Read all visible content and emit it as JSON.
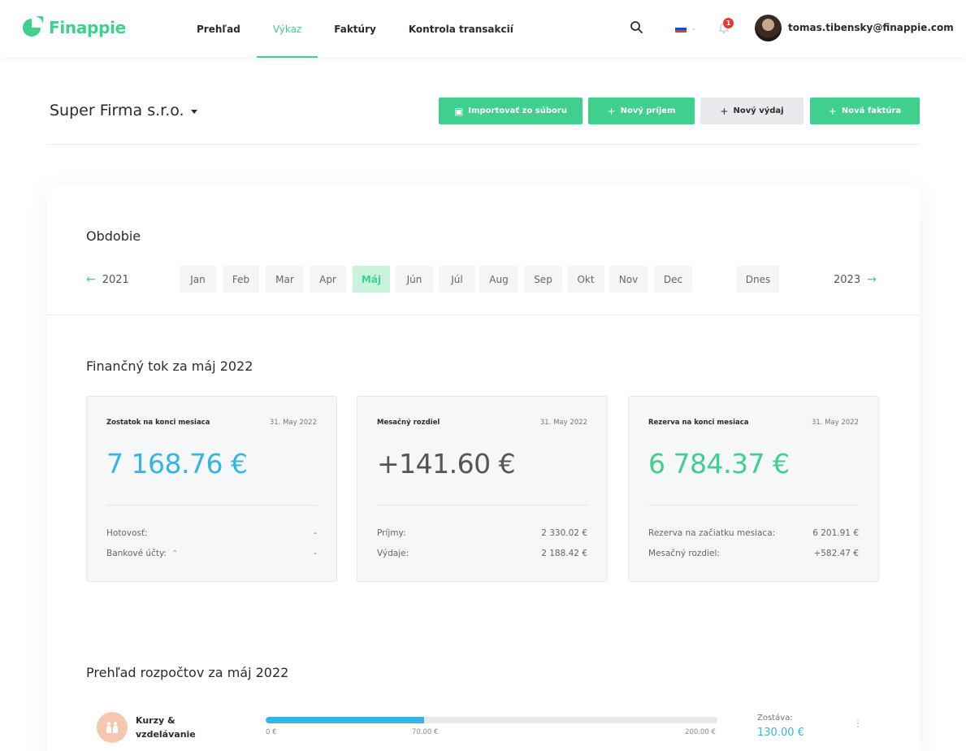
{
  "app": {
    "name": "Finappie"
  },
  "nav": {
    "items": [
      {
        "label": "Prehľad",
        "active": false
      },
      {
        "label": "Výkaz",
        "active": true
      },
      {
        "label": "Faktúry",
        "active": false
      },
      {
        "label": "Kontrola transakcií",
        "active": false
      }
    ],
    "search_icon": "search-icon",
    "language": "sk",
    "notifications_count": "1",
    "user_email": "tomas.tibensky@finappie.com"
  },
  "header": {
    "company": "Super Firma s.r.o.",
    "buttons": {
      "import": "Importovať zo súboru",
      "new_income": "Nový príjem",
      "new_expense": "Nový výdaj",
      "new_invoice": "Nová faktúra"
    }
  },
  "period": {
    "title": "Obdobie",
    "prev_year": "2021",
    "next_year": "2023",
    "months": [
      "Jan",
      "Feb",
      "Mar",
      "Apr",
      "Máj",
      "Jún",
      "Júl",
      "Aug",
      "Sep",
      "Okt",
      "Nov",
      "Dec"
    ],
    "active_month": "Máj",
    "today_label": "Dnes"
  },
  "cashflow": {
    "title": "Finančný tok za máj 2022",
    "tiles": [
      {
        "title": "Zostatok na konci mesiaca",
        "date": "31. May 2022",
        "amount": "7 168.76 €",
        "rows": [
          {
            "label": "Hotovosť:",
            "value": "-"
          },
          {
            "label": "Bankové účty:",
            "value": "-"
          }
        ]
      },
      {
        "title": "Mesačný rozdiel",
        "date": "31. May 2022",
        "amount": "+141.60 €",
        "rows": [
          {
            "label": "Príjmy:",
            "value": "2 330.02 €"
          },
          {
            "label": "Výdaje:",
            "value": "2 188.42 €"
          }
        ]
      },
      {
        "title": "Rezerva na konci mesiaca",
        "date": "31. May 2022",
        "amount": "6 784.37 €",
        "rows": [
          {
            "label": "Rezerva na začiatku mesiaca:",
            "value": "6 201.91 €"
          },
          {
            "label": "Mesačný rozdiel:",
            "value": "+582.47 €"
          }
        ]
      }
    ]
  },
  "budgets": {
    "title": "Prehľad rozpočtov za máj 2022",
    "items": [
      {
        "name": "Kurzy & vzdelávanie",
        "icon": "people-icon",
        "spent_fraction": 0.35,
        "tick_start": "0 €",
        "tick_spent": "70.00 €",
        "tick_total": "200.00 €",
        "remaining_label": "Zostáva:",
        "remaining": "130.00 €"
      }
    ]
  },
  "colors": {
    "accent": "#3ed08c",
    "accent_light": "#c9f3dd",
    "blue": "#32b6e5",
    "badge": "#e53935",
    "budget_icon_bg": "#f6c7ae"
  }
}
